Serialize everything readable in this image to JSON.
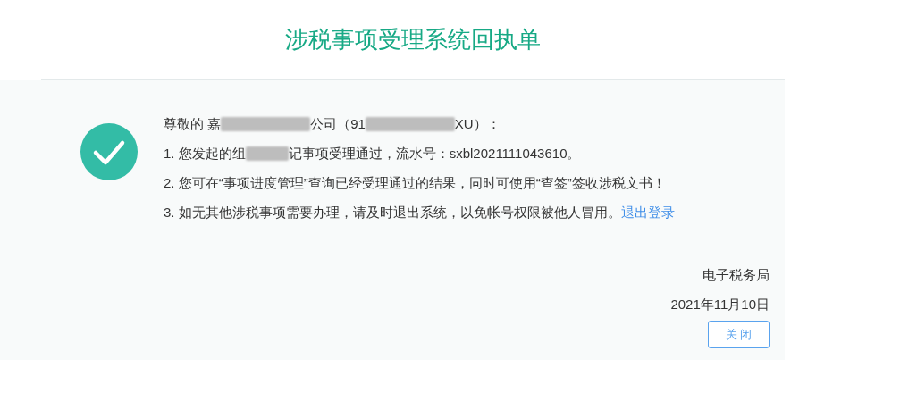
{
  "title": "涉税事项受理系统回执单",
  "lines": [
    {
      "segments": [
        {
          "kind": "text",
          "text": "尊敬的 嘉"
        },
        {
          "kind": "redaction"
        },
        {
          "kind": "text",
          "text": "公司（91"
        },
        {
          "kind": "redaction"
        },
        {
          "kind": "text",
          "text": "XU）："
        }
      ]
    },
    {
      "segments": [
        {
          "kind": "text",
          "text": "1. 您发起的组"
        },
        {
          "kind": "redaction"
        },
        {
          "kind": "text",
          "text": "记事项受理通过，流水号：sxbl2021111043610。"
        }
      ]
    },
    {
      "segments": [
        {
          "kind": "text",
          "text": "2. 您可在“事项进度管理”查询已经受理通过的结果，同时可使用“查签”签收涉税文书！"
        }
      ]
    },
    {
      "segments": [
        {
          "kind": "text",
          "text": "3. 如无其他涉税事项需要办理，请及时退出系统，以免帐号权限被他人冒用。"
        },
        {
          "kind": "link",
          "text": "退出登录"
        }
      ]
    }
  ],
  "signature": "电子税务局",
  "date": "2021年11月10日",
  "close_button": "关 闭"
}
